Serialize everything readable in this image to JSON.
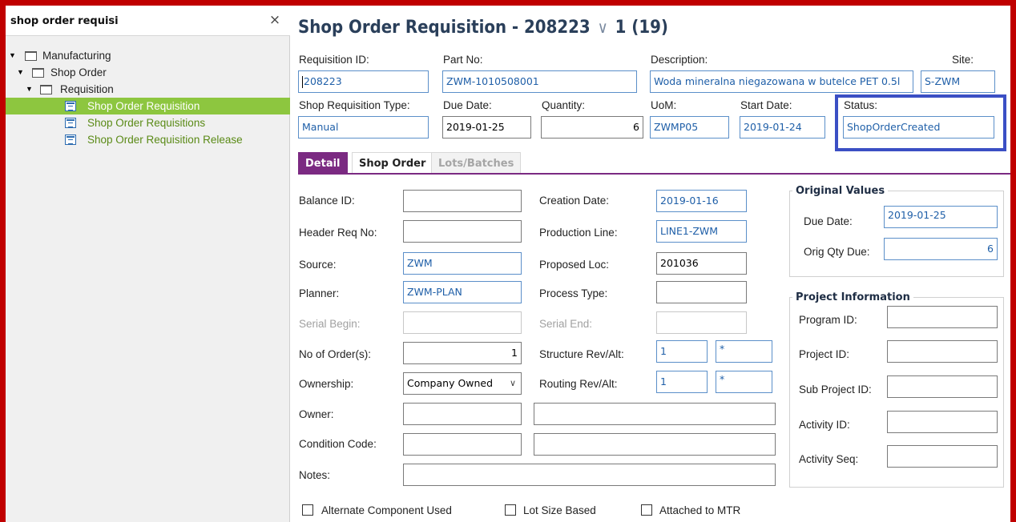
{
  "navigator": {
    "search_value": "shop order requisi",
    "close_glyph": "×",
    "tree": [
      {
        "label": "Manufacturing",
        "level": 0,
        "type": "folder",
        "expanded": true
      },
      {
        "label": "Shop Order",
        "level": 1,
        "type": "folder",
        "expanded": true
      },
      {
        "label": "Requisition",
        "level": 2,
        "type": "folder",
        "expanded": true
      },
      {
        "label": "Shop Order Requisition",
        "level": 3,
        "type": "page",
        "selected": true
      },
      {
        "label": "Shop Order Requisitions",
        "level": 3,
        "type": "page"
      },
      {
        "label": "Shop Order Requisition Release",
        "level": 3,
        "type": "page"
      }
    ]
  },
  "header": {
    "title": "Shop Order Requisition - 208223",
    "chevron": "∨",
    "record_position": "1 (19)"
  },
  "fields": {
    "requisition_id": {
      "label": "Requisition ID:",
      "value": "208223"
    },
    "part_no": {
      "label": "Part No:",
      "value": "ZWM-1010508001"
    },
    "description": {
      "label": "Description:",
      "value": "Woda mineralna niegazowana w butelce PET 0.5l"
    },
    "site": {
      "label": "Site:",
      "value": "S-ZWM"
    },
    "shop_requisition_type": {
      "label": "Shop Requisition Type:",
      "value": "Manual"
    },
    "due_date": {
      "label": "Due Date:",
      "value": "2019-01-25"
    },
    "quantity": {
      "label": "Quantity:",
      "value": "6"
    },
    "uom": {
      "label": "UoM:",
      "value": "ZWMP05"
    },
    "start_date": {
      "label": "Start Date:",
      "value": "2019-01-24"
    },
    "status": {
      "label": "Status:",
      "value": "ShopOrderCreated"
    }
  },
  "tabs": [
    {
      "label": "Detail",
      "state": "active"
    },
    {
      "label": "Shop Order",
      "state": "normal"
    },
    {
      "label": "Lots/Batches",
      "state": "disabled"
    }
  ],
  "detail": {
    "balance_id": {
      "label": "Balance ID:",
      "value": ""
    },
    "header_req_no": {
      "label": "Header Req No:",
      "value": ""
    },
    "source": {
      "label": "Source:",
      "value": "ZWM"
    },
    "planner": {
      "label": "Planner:",
      "value": "ZWM-PLAN"
    },
    "serial_begin": {
      "label": "Serial Begin:",
      "value": ""
    },
    "no_of_orders": {
      "label": "No of Order(s):",
      "value": "1"
    },
    "ownership": {
      "label": "Ownership:",
      "value": "Company Owned"
    },
    "owner": {
      "label": "Owner:",
      "value": "",
      "desc": ""
    },
    "condition_code": {
      "label": "Condition Code:",
      "value": "",
      "desc": ""
    },
    "notes": {
      "label": "Notes:",
      "value": ""
    },
    "creation_date": {
      "label": "Creation Date:",
      "value": "2019-01-16"
    },
    "production_line": {
      "label": "Production Line:",
      "value": "LINE1-ZWM"
    },
    "proposed_loc": {
      "label": "Proposed Loc:",
      "value": "201036"
    },
    "process_type": {
      "label": "Process Type:",
      "value": ""
    },
    "serial_end": {
      "label": "Serial End:",
      "value": ""
    },
    "structure_rev_alt": {
      "label": "Structure Rev/Alt:",
      "rev": "1",
      "alt": "*"
    },
    "routing_rev_alt": {
      "label": "Routing Rev/Alt:",
      "rev": "1",
      "alt": "*"
    }
  },
  "original_values": {
    "title": "Original Values",
    "due_date": {
      "label": "Due Date:",
      "value": "2019-01-25"
    },
    "orig_qty_due": {
      "label": "Orig Qty Due:",
      "value": "6"
    }
  },
  "project_info": {
    "title": "Project Information",
    "program_id": {
      "label": "Program ID:",
      "value": ""
    },
    "project_id": {
      "label": "Project ID:",
      "value": ""
    },
    "sub_project_id": {
      "label": "Sub Project ID:",
      "value": ""
    },
    "activity_id": {
      "label": "Activity ID:",
      "value": ""
    },
    "activity_seq": {
      "label": "Activity Seq:",
      "value": ""
    }
  },
  "checkboxes": [
    {
      "label": "Alternate Component Used",
      "checked": false
    },
    {
      "label": "Lot Size Based",
      "checked": false
    },
    {
      "label": "Attached to MTR",
      "checked": false
    }
  ],
  "colors": {
    "frame_border": "#c00000",
    "selected_tree_bg": "#8dc63f",
    "active_tab": "#7b2a82",
    "status_highlight": "#3b4fc4",
    "field_value_blue": "#1f5fa8"
  }
}
